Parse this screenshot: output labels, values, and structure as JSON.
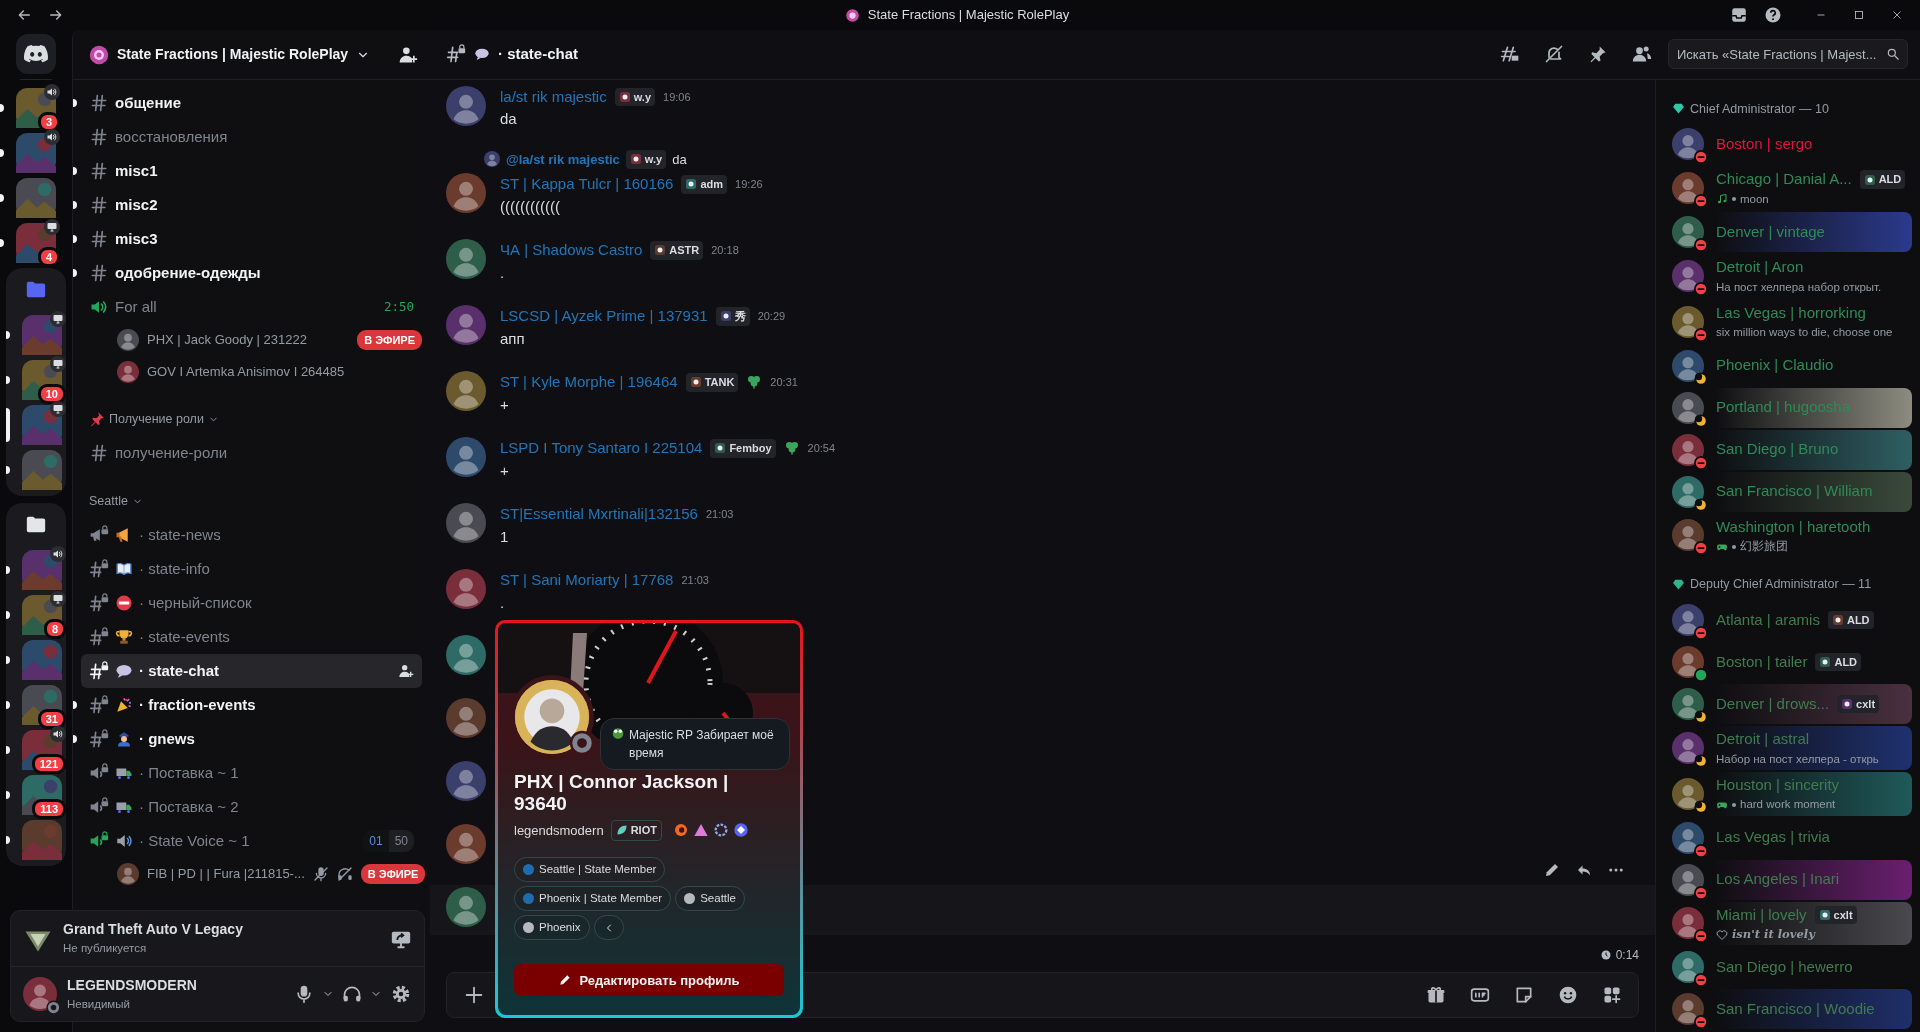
{
  "window": {
    "title": "State Fractions | Majestic RolePlay"
  },
  "servers": [
    {
      "kind": "home"
    },
    {
      "kind": "server",
      "unread": true,
      "selected": false,
      "voice": {
        "kind": "speaker"
      },
      "badge": "3"
    },
    {
      "kind": "server",
      "unread": true,
      "selected": false,
      "voice": {
        "kind": "speaker"
      }
    },
    {
      "kind": "server",
      "unread": true,
      "selected": false
    },
    {
      "kind": "server",
      "unread": true,
      "selected": false,
      "voice": {
        "kind": "screen"
      },
      "badge": "4"
    },
    {
      "kind": "folder",
      "color": "#5865f2",
      "children": [
        {
          "kind": "server",
          "unread": true,
          "selected": false,
          "voice": {
            "kind": "screen"
          }
        },
        {
          "kind": "server",
          "unread": true,
          "selected": false,
          "voice": {
            "kind": "screen"
          },
          "badge": "10"
        },
        {
          "kind": "server",
          "unread": false,
          "selected": true,
          "voice": {
            "kind": "screen"
          }
        },
        {
          "kind": "server",
          "unread": true,
          "selected": false
        }
      ]
    },
    {
      "kind": "folder",
      "color": "#e3e5e8",
      "children": [
        {
          "kind": "server",
          "unread": true,
          "selected": false,
          "voice": {
            "kind": "speaker"
          }
        },
        {
          "kind": "server",
          "unread": true,
          "selected": false,
          "voice": {
            "kind": "screen"
          },
          "badge": "8"
        },
        {
          "kind": "server",
          "unread": true,
          "selected": false
        },
        {
          "kind": "server",
          "unread": true,
          "selected": false,
          "badge": "31"
        },
        {
          "kind": "server",
          "unread": true,
          "selected": false,
          "voice": {
            "kind": "speaker"
          },
          "badge": "121"
        },
        {
          "kind": "server",
          "unread": true,
          "selected": false,
          "badge": "113"
        },
        {
          "kind": "server",
          "unread": true,
          "selected": false
        }
      ]
    }
  ],
  "server_header": {
    "title": "State Fractions | Majestic RolePlay"
  },
  "channels": [
    {
      "kind": "text",
      "name": "общение",
      "unread": true,
      "selected": false,
      "locked": false
    },
    {
      "kind": "text",
      "name": "восстановления",
      "unread": false,
      "selected": false,
      "locked": false
    },
    {
      "kind": "text",
      "name": "misc1",
      "unread": true,
      "selected": false,
      "locked": false
    },
    {
      "kind": "text",
      "name": "misc2",
      "unread": true,
      "selected": false,
      "locked": false
    },
    {
      "kind": "text",
      "name": "misc3",
      "unread": true,
      "selected": false,
      "locked": false
    },
    {
      "kind": "text",
      "name": "одобрение-одежды",
      "unread": true,
      "selected": false,
      "locked": false
    },
    {
      "kind": "voice",
      "name": "For all",
      "unread": false,
      "selected": false,
      "locked": false,
      "active": true,
      "timer": "2:50",
      "members": [
        {
          "name": "PHX | Jack Goody | 231222",
          "live": "В ЭФИРЕ",
          "muted": false,
          "deafened": false
        },
        {
          "name": "GOV I Artemka Anisimov I 264485",
          "muted": false,
          "deafened": false
        }
      ]
    },
    {
      "kind": "category",
      "name": "Получение роли",
      "emoji": {
        "kind": "pin"
      }
    },
    {
      "kind": "text",
      "name": "получение-роли",
      "unread": false,
      "selected": false,
      "locked": false
    },
    {
      "kind": "category",
      "name": "Seattle"
    },
    {
      "kind": "announcement",
      "name": "· state-news",
      "emoji": {
        "kind": "megaphone"
      },
      "unread": false,
      "selected": false,
      "locked": true
    },
    {
      "kind": "text",
      "name": "· state-info",
      "emoji": {
        "kind": "book"
      },
      "unread": false,
      "selected": false,
      "locked": true
    },
    {
      "kind": "text",
      "name": "· черный-список",
      "emoji": {
        "kind": "noentry"
      },
      "unread": false,
      "selected": false,
      "locked": true
    },
    {
      "kind": "text",
      "name": "· state-events",
      "emoji": {
        "kind": "trophy"
      },
      "unread": false,
      "selected": false,
      "locked": true
    },
    {
      "kind": "text",
      "name": "· state-chat",
      "emoji": {
        "kind": "speech"
      },
      "unread": false,
      "selected": true,
      "locked": true
    },
    {
      "kind": "text",
      "name": "· fraction-events",
      "emoji": {
        "kind": "party"
      },
      "unread": true,
      "selected": false,
      "locked": true
    },
    {
      "kind": "text",
      "name": "· gnews",
      "emoji": {
        "kind": "officer"
      },
      "unread": true,
      "selected": false,
      "locked": true
    },
    {
      "kind": "voice",
      "name": "· Поставка ~ 1",
      "emoji": {
        "kind": "truck"
      },
      "unread": false,
      "selected": false,
      "locked": true,
      "active": false
    },
    {
      "kind": "voice",
      "name": "· Поставка ~ 2",
      "emoji": {
        "kind": "truck"
      },
      "unread": false,
      "selected": false,
      "locked": true,
      "active": false
    },
    {
      "kind": "voice",
      "name": "· State Voice ~ 1",
      "emoji": {
        "kind": "speaker"
      },
      "unread": false,
      "selected": false,
      "locked": true,
      "active": true,
      "limit": [
        "01",
        "50"
      ],
      "members": [
        {
          "name": "FIB | PD | | Fura |211815-...",
          "live": "В ЭФИРЕ",
          "muted": true,
          "deafened": true
        }
      ]
    }
  ],
  "activity": {
    "title": "Grand Theft Auto V Legacy",
    "subtitle": "Не публикуется"
  },
  "user": {
    "name": "LEGENDSMODERN",
    "status_text": "Невидимый",
    "status": {
      "kind": "invisible"
    }
  },
  "chat_header": {
    "channel": "· state-chat",
    "emoji": {
      "kind": "speech"
    },
    "search": {
      "placeholder": "Искать «State Fractions | Majest..."
    }
  },
  "messages": [
    {
      "kind": "message",
      "author": "la/st rik majestic",
      "tag": "w.y",
      "time": "19:06",
      "text": "da",
      "clover": false
    },
    {
      "kind": "message",
      "reply": {
        "author": "@la/st rik majestic",
        "tag": "w.y",
        "text": "da"
      },
      "author": "ST | Kappa Tulcr | 160166",
      "tag": "adm",
      "time": "19:26",
      "text": "((((((((((((",
      "clover": false
    },
    {
      "kind": "message",
      "author": "ЧА | Shadows Castro",
      "tag": "ASTR",
      "time": "20:18",
      "text": ".",
      "clover": false
    },
    {
      "kind": "message",
      "author": "LSCSD | Ayzek Prime | 137931",
      "tag": "秀",
      "time": "20:29",
      "text": "апп",
      "clover": false
    },
    {
      "kind": "message",
      "author": "ST | Kyle Morphe | 196464",
      "tag": "TANK",
      "time": "20:31",
      "text": "+",
      "clover": true
    },
    {
      "kind": "message",
      "author": "LSPD I Tony Santaro I 225104",
      "tag": "Femboy",
      "time": "20:54",
      "text": "+",
      "clover": true
    },
    {
      "kind": "message",
      "author": "ST|Essential Mxrtinali|132156",
      "time": "21:03",
      "text": "1",
      "clover": false
    },
    {
      "kind": "message",
      "author": "ST | Sani Moriarty | 17768",
      "time": "21:03",
      "text": ".",
      "clover": false
    },
    {
      "kind": "covered",
      "hovered": false
    },
    {
      "kind": "covered",
      "hovered": false
    },
    {
      "kind": "covered",
      "hovered": false
    },
    {
      "kind": "covered",
      "hovered": false
    },
    {
      "kind": "covered",
      "hovered": true
    }
  ],
  "composer": {
    "elapsed": "0:14"
  },
  "profile_popup": {
    "status": {
      "kind": "invisible"
    },
    "custom_status": "Majestic RP Забирает моё время",
    "display_name": "PHX | Connor Jackson | 93640",
    "username": "legendsmodern",
    "tag": "RIOT",
    "roles": [
      {
        "name": "Seattle | State Member",
        "color": "#1f6bb0"
      },
      {
        "name": "Phoenix | State Member",
        "color": "#1f6bb0"
      },
      {
        "name": "Seattle",
        "color": "#b5b9bf"
      },
      {
        "name": "Phoenix",
        "color": "#b5b9bf"
      }
    ],
    "edit_button": "Редактировать профиль"
  },
  "member_groups": [
    {
      "title": "Chief Administrator — 10",
      "color": "#2fc7a6",
      "members": [
        {
          "name": "Boston | sergo",
          "color": "#e0143c",
          "status": {
            "kind": "dnd"
          }
        },
        {
          "name": "Chicago | Danial A...",
          "color": "#2e8b57",
          "status": {
            "kind": "dnd"
          },
          "tag": "ALD",
          "activity": {
            "kind": "music",
            "text": "moon"
          }
        },
        {
          "name": "Denver | vintage",
          "color": "#2e8b57",
          "status": {
            "kind": "dnd"
          },
          "nameplate": {
            "color": "#2b3a8c"
          }
        },
        {
          "name": "Detroit | Aron",
          "color": "#2e8b57",
          "status": {
            "kind": "dnd"
          },
          "activity": {
            "kind": "text",
            "text": "На пост хелпера набор открыт."
          }
        },
        {
          "name": "Las Vegas | horrorking",
          "color": "#2e8b57",
          "status": {
            "kind": "dnd"
          },
          "activity": {
            "kind": "text",
            "text": "six million ways to die, choose one"
          }
        },
        {
          "name": "Phoenix | Claudio",
          "color": "#2e8b57",
          "status": {
            "kind": "idle"
          }
        },
        {
          "name": "Portland | hugoosha",
          "color": "#2e8b57",
          "status": {
            "kind": "idle"
          },
          "nameplate": {
            "color": "#8c8c80"
          }
        },
        {
          "name": "San Diego | Bruno",
          "color": "#2e8b57",
          "status": {
            "kind": "dnd"
          },
          "nameplate": {
            "color": "#2f5f63"
          }
        },
        {
          "name": "San Francisco | William",
          "color": "#2e8b57",
          "status": {
            "kind": "idle"
          },
          "nameplate": {
            "color": "#3a4a3a"
          }
        },
        {
          "name": "Washington | haretooth",
          "color": "#2e8b57",
          "status": {
            "kind": "dnd"
          },
          "activity": {
            "kind": "game",
            "text": "幻影旅团"
          }
        }
      ]
    },
    {
      "title": "Deputy Chief Administrator — 11",
      "color": "#2fb58a",
      "members": [
        {
          "name": "Atlanta | aramis",
          "color": "#3f7d4f",
          "status": {
            "kind": "dnd"
          },
          "tag": "ALD"
        },
        {
          "name": "Boston | tailer",
          "color": "#3f7d4f",
          "status": {
            "kind": "online"
          },
          "tag": "ALD"
        },
        {
          "name": "Denver | drows...",
          "color": "#3f7d4f",
          "status": {
            "kind": "idle"
          },
          "tag": "cxlt",
          "nameplate": {
            "color": "#4a3040"
          }
        },
        {
          "name": "Detroit | astral",
          "color": "#3f7d4f",
          "status": {
            "kind": "idle"
          },
          "nameplate": {
            "color": "#1f3170"
          },
          "activity": {
            "kind": "text",
            "text": "Набор на пост хелпера - открь"
          }
        },
        {
          "name": "Houston | sincerity",
          "color": "#3f7d4f",
          "status": {
            "kind": "idle"
          },
          "nameplate": {
            "color": "#1f5a5a"
          },
          "activity": {
            "kind": "game",
            "text": "hard work moment"
          }
        },
        {
          "name": "Las Vegas | trivia",
          "color": "#3f7d4f",
          "status": {
            "kind": "dnd"
          }
        },
        {
          "name": "Los Angeles | Inari",
          "color": "#3f7d4f",
          "status": {
            "kind": "dnd"
          },
          "nameplate": {
            "color": "#6a1f70"
          }
        },
        {
          "name": "Miami | lovely",
          "color": "#3f7d4f",
          "status": {
            "kind": "dnd"
          },
          "tag": "cxlt",
          "nameplate": {
            "color": "#4a4a4e"
          },
          "activity": {
            "kind": "heart",
            "text": "isn't it lovely"
          }
        },
        {
          "name": "San Diego | hewerro",
          "color": "#3f7d4f",
          "status": {
            "kind": "dnd"
          }
        },
        {
          "name": "San Francisco | Woodie",
          "color": "#3f7d4f",
          "status": {
            "kind": "dnd"
          },
          "nameplate": {
            "color": "#1f2f6a"
          }
        }
      ]
    }
  ]
}
